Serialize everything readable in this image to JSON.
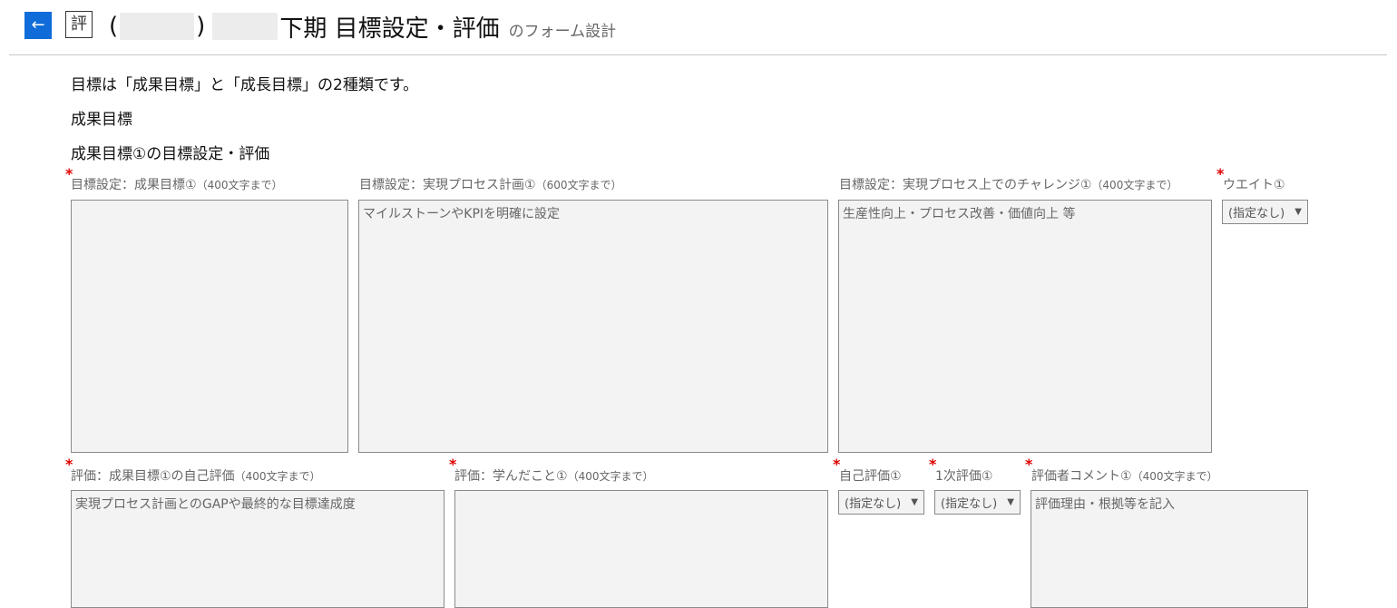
{
  "header": {
    "back_icon": "←",
    "logo_char": "評",
    "paren_open": "(",
    "paren_close": ")",
    "title": "下期 目標設定・評価",
    "subtitle": "のフォーム設計"
  },
  "intro": {
    "description": "目標は「成果目標」と「成長目標」の2種類です。",
    "section_title": "成果目標",
    "subsection_title": "成果目標①の目標設定・評価"
  },
  "row1": {
    "goal": {
      "label": "目標設定：成果目標①",
      "hint": "（400文字まで）",
      "value": "",
      "placeholder": ""
    },
    "process": {
      "label": "目標設定：実現プロセス計画①",
      "hint": "（600文字まで）",
      "placeholder": "マイルストーンやKPIを明確に設定"
    },
    "challenge": {
      "label": "目標設定：実現プロセス上でのチャレンジ①",
      "hint": "（400文字まで）",
      "placeholder": "生産性向上・プロセス改善・価値向上 等"
    },
    "weight": {
      "label": "ウエイト①",
      "value": "(指定なし)"
    }
  },
  "row2": {
    "self_eval": {
      "label": "評価：成果目標①の自己評価",
      "hint": "（400文字まで）",
      "placeholder": "実現プロセス計画とのGAPや最終的な目標達成度"
    },
    "learned": {
      "label": "評価：学んだこと①",
      "hint": "（400文字まで）",
      "placeholder": ""
    },
    "self_rating": {
      "label": "自己評価①",
      "value": "(指定なし)"
    },
    "first_rating": {
      "label": "1次評価①",
      "value": "(指定なし)"
    },
    "comment": {
      "label": "評価者コメント①",
      "hint": "（400文字まで）",
      "placeholder": "評価理由・根拠等を記入"
    }
  },
  "required_mark": "*",
  "caret_icon": "▼",
  "colors": {
    "accent": "#0f6cd9",
    "required": "#e00000",
    "field_bg": "#f3f3f3"
  }
}
